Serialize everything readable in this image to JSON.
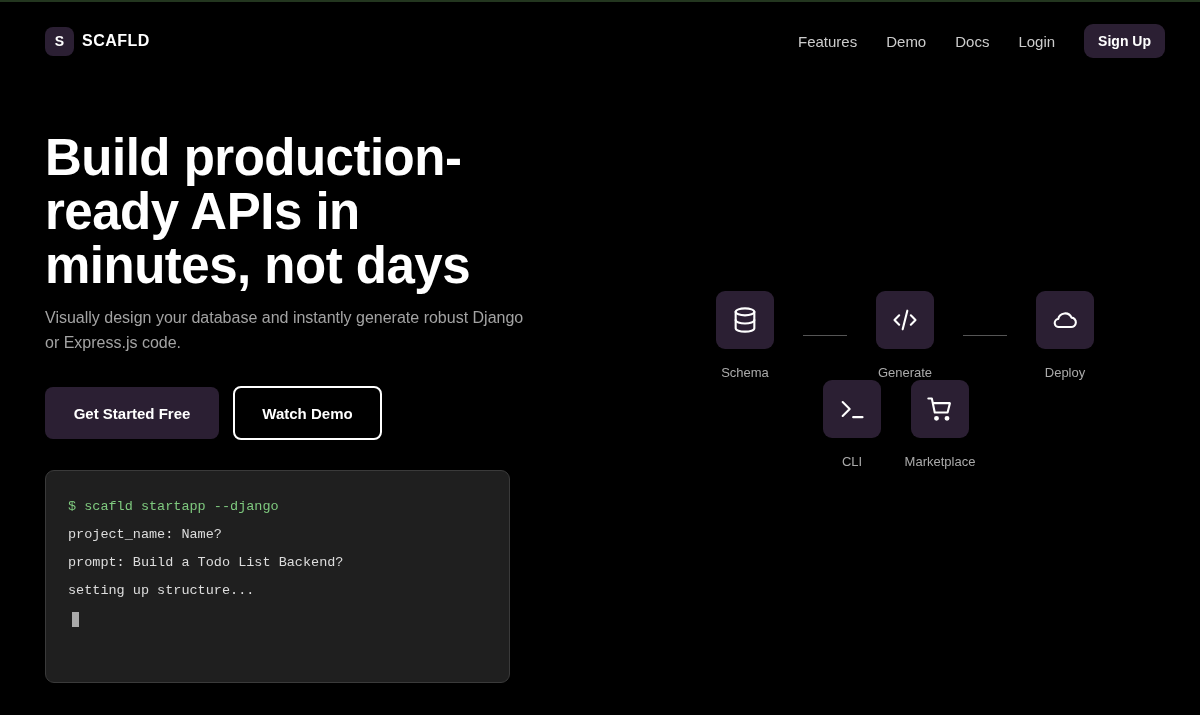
{
  "brand": {
    "mark": "S",
    "name": "SCAFLD"
  },
  "nav": [
    {
      "label": "Features",
      "kind": "link"
    },
    {
      "label": "Demo",
      "kind": "link"
    },
    {
      "label": "Docs",
      "kind": "link"
    },
    {
      "label": "Login",
      "kind": "link"
    },
    {
      "label": "Sign Up",
      "kind": "button"
    }
  ],
  "hero": {
    "title": "Build production-ready APIs in minutes, not days",
    "subtitle": "Visually design your database and instantly generate robust Django or Express.js code.",
    "buttons": [
      {
        "label": "Get Started Free",
        "kind": "primary"
      },
      {
        "label": "Watch Demo",
        "kind": "outline"
      }
    ]
  },
  "terminal": {
    "lines": [
      {
        "text": "$ scafld startapp --django",
        "kind": "command"
      },
      {
        "text": "project_name: Name?",
        "kind": "output"
      },
      {
        "text": "prompt: Build a Todo List Backend?",
        "kind": "output"
      },
      {
        "text": "setting up structure...",
        "kind": "output"
      }
    ],
    "cursor": true
  },
  "steps": [
    {
      "label": "Schema"
    },
    {
      "label": "Generate"
    },
    {
      "label": "Deploy"
    }
  ],
  "tools": [
    {
      "label": "CLI"
    },
    {
      "label": "Marketplace"
    }
  ]
}
